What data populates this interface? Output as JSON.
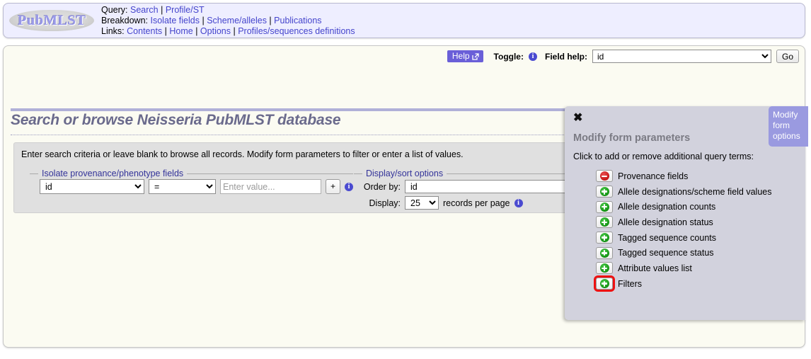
{
  "header": {
    "logo_text": "PubMLST",
    "rows": [
      {
        "label": "Query:",
        "links": [
          "Search",
          "Profile/ST"
        ]
      },
      {
        "label": "Breakdown:",
        "links": [
          "Isolate fields",
          "Scheme/alleles",
          "Publications"
        ]
      },
      {
        "label": "Links:",
        "links": [
          "Contents",
          "Home",
          "Options",
          "Profiles/sequences definitions"
        ]
      }
    ]
  },
  "toolbar": {
    "help_label": "Help",
    "help_icon": "external-link-icon",
    "toggle_label": "Toggle:",
    "toggle_icon": "info-icon",
    "field_help_label": "Field help:",
    "field_help_value": "id",
    "go_label": "Go"
  },
  "page": {
    "title": "Search or browse Neisseria PubMLST database",
    "instruction": "Enter search criteria or leave blank to browse all records. Modify form parameters to filter or enter a list of values."
  },
  "provenance": {
    "legend": "Isolate provenance/phenotype fields",
    "field_value": "id",
    "operator_value": "=",
    "value_placeholder": "Enter value...",
    "value_text": "",
    "add_label": "+",
    "info_icon": "info-icon"
  },
  "display_options": {
    "legend": "Display/sort options",
    "order_by_label": "Order by:",
    "order_by_value": "id",
    "display_label": "Display:",
    "records_value": "25",
    "records_suffix": "records per page",
    "info_icon": "info-icon"
  },
  "modify_panel": {
    "close_icon": "✖",
    "title": "Modify form parameters",
    "subtitle": "Click to add or remove additional query terms:",
    "items": [
      {
        "label": "Provenance fields",
        "state": "minus",
        "highlighted": false
      },
      {
        "label": "Allele designations/scheme field values",
        "state": "plus",
        "highlighted": false
      },
      {
        "label": "Allele designation counts",
        "state": "plus",
        "highlighted": false
      },
      {
        "label": "Allele designation status",
        "state": "plus",
        "highlighted": false
      },
      {
        "label": "Tagged sequence counts",
        "state": "plus",
        "highlighted": false
      },
      {
        "label": "Tagged sequence status",
        "state": "plus",
        "highlighted": false
      },
      {
        "label": "Attribute values list",
        "state": "plus",
        "highlighted": false
      },
      {
        "label": "Filters",
        "state": "plus",
        "highlighted": true
      }
    ]
  },
  "options_tab": {
    "label": "Modify form options"
  },
  "colors": {
    "accent_purple": "#6a5fd8",
    "tab_purple": "#9a9ae0",
    "panel_bg": "#d2d2dd",
    "header_bg": "#eeeeff",
    "content_bg": "#fbfbf2",
    "link_blue": "#4444cc",
    "legend_blue": "#333399",
    "title_gray": "#6a6a8c",
    "highlight_red": "#ee1111",
    "plus_green": "#149314",
    "minus_red": "#c61515"
  }
}
